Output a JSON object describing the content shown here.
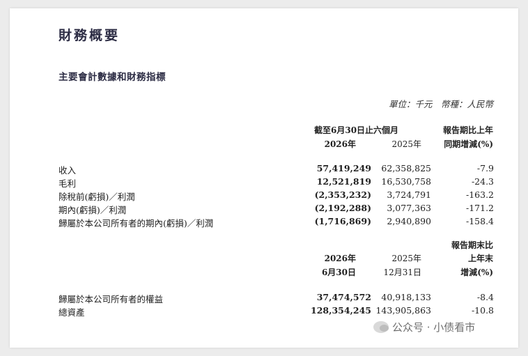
{
  "title": "財務概要",
  "subtitle": "主要會計數據和財務指標",
  "unit_note": "單位：千元　幣種：人民幣",
  "period_table": {
    "header_group": "截至6月30日止六個月",
    "col1": "2026年",
    "col2": "2025年",
    "col3_line1": "報告期比上年",
    "col3_line2": "同期增減(%)",
    "rows": [
      {
        "label": "收入",
        "v2026": "57,419,249",
        "v2025": "62,358,825",
        "change": "-7.9"
      },
      {
        "label": "毛利",
        "v2026": "12,521,819",
        "v2025": "16,530,758",
        "change": "-24.3"
      },
      {
        "label": "除稅前(虧損)／利潤",
        "v2026": "(2,353,232)",
        "v2025": "3,724,791",
        "change": "-163.2"
      },
      {
        "label": "期內(虧損)／利潤",
        "v2026": "(2,192,288)",
        "v2025": "3,077,363",
        "change": "-171.2"
      },
      {
        "label": "歸屬於本公司所有者的期內(虧損)／利潤",
        "v2026": "(1,716,869)",
        "v2025": "2,940,890",
        "change": "-158.4"
      }
    ]
  },
  "balance_table": {
    "col1_line1": "2026年",
    "col1_line2": "6月30日",
    "col2_line1": "2025年",
    "col2_line2": "12月31日",
    "col3_line1": "報告期末比",
    "col3_line2": "上年末",
    "col3_line3": "增減(%)",
    "rows": [
      {
        "label": "歸屬於本公司所有者的權益",
        "v2026": "37,474,572",
        "v2025": "40,918,133",
        "change": "-8.4"
      },
      {
        "label": "總資產",
        "v2026": "128,354,245",
        "v2025": "143,905,863",
        "change": "-10.8"
      }
    ]
  },
  "watermark": {
    "text": "公众号 · 小债看市",
    "icon": "wechat-bubble-icon"
  }
}
